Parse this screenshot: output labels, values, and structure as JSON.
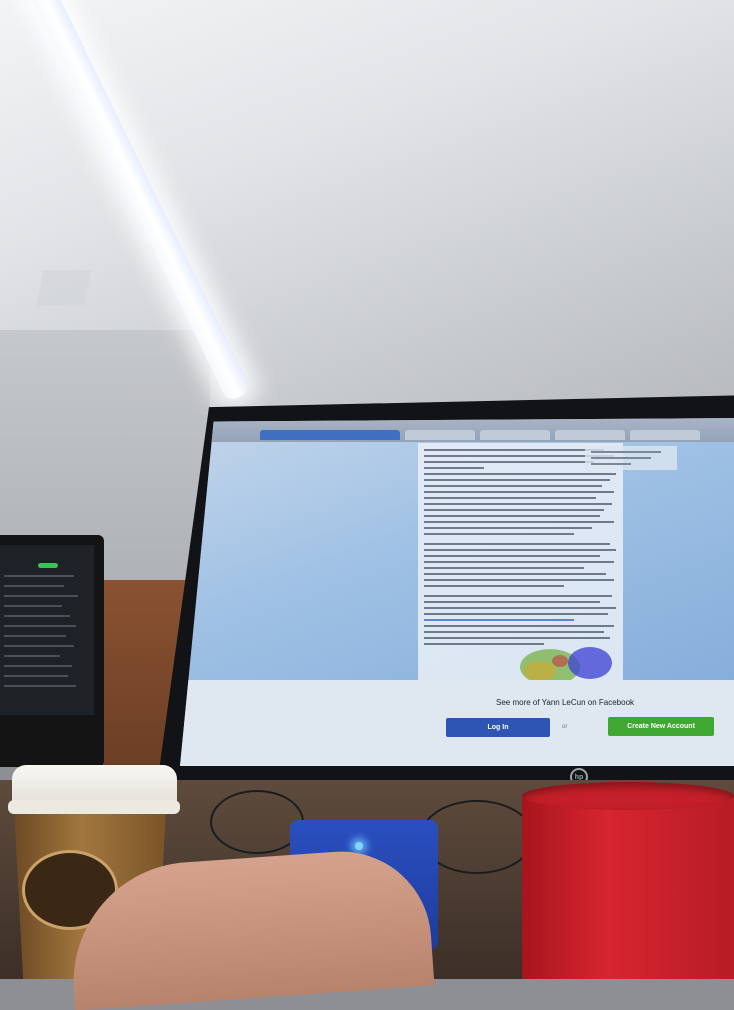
{
  "screen": {
    "facebook_prompt": "See more of Yann LeCun on Facebook",
    "login_label": "Log In",
    "separator": "or",
    "create_account_label": "Create New Account",
    "brand_colors": {
      "login_button": "#2e54b4",
      "create_button": "#3ea832",
      "browser_bar": "#94a3b8"
    }
  },
  "monitor": {
    "brand_logo": "hp"
  },
  "objects": [
    "ceiling-light-icon",
    "coffee-cup-icon",
    "speaker-icon",
    "red-mug-icon",
    "hand-icon"
  ]
}
